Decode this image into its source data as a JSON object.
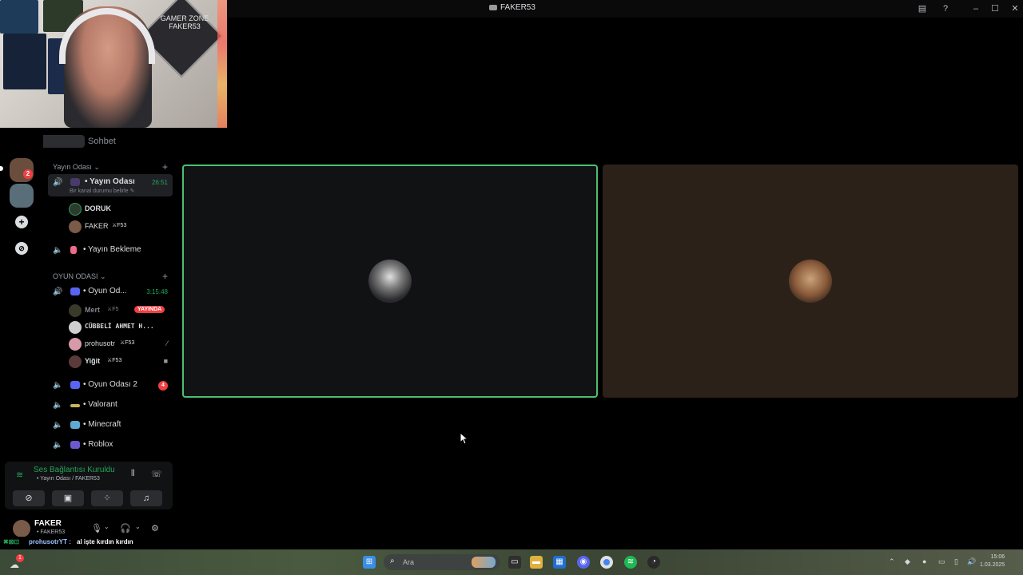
{
  "window": {
    "title": "FAKER53"
  },
  "webcam": {
    "poster_text": "GAMER ZONE FAKER53"
  },
  "server": {
    "header_text": "Sohbet"
  },
  "rail": {
    "badge_count": "2"
  },
  "channels": {
    "cat1": {
      "label": "Yayın Odası ⌄"
    },
    "yayin_odasi": {
      "name": "• Yayın Odası",
      "timer": "26:51",
      "sub": "Bir kanal durumu belirle ✎"
    },
    "members1": [
      {
        "name": "DORUK",
        "tag": ""
      },
      {
        "name": "FAKER",
        "tag": "⚔F53"
      }
    ],
    "yayin_bekleme": {
      "name": "• Yayın Bekleme"
    },
    "cat2": {
      "label": "OYUN ODASI ⌄"
    },
    "oyun_odasi": {
      "name": "• Oyun Od...",
      "timer": "3:15:48"
    },
    "members2": [
      {
        "name": "Mert",
        "tag": "⚔F5",
        "live": "YAYINDA"
      },
      {
        "name": "CÜBBELİ AHMET H...",
        "tag": ""
      },
      {
        "name": "prohusotr",
        "tag": "⚔F53"
      },
      {
        "name": "Yiğit",
        "tag": "⚔F53"
      }
    ],
    "oyun_odasi_2": {
      "name": "• Oyun Odası 2",
      "count": "4"
    },
    "valorant": {
      "name": "• Valorant"
    },
    "minecraft": {
      "name": "• Minecraft"
    },
    "roblox": {
      "name": "• Roblox"
    }
  },
  "voice_panel": {
    "status": "Ses Bağlantısı Kuruldu",
    "sub": "• Yayın Odası / FAKER53"
  },
  "userbar": {
    "name": "FAKER",
    "status": "• FAKER53"
  },
  "chat_overlay": {
    "icons": "✖⊠⊡",
    "user": "prohusotrYT :",
    "message": "al işte kırdın kırdın"
  },
  "taskbar": {
    "search_placeholder": "Ara",
    "notification_count": "1",
    "clock_time": "15:06",
    "clock_date": "1.03.2025"
  },
  "colors": {
    "accent_green": "#23a559",
    "danger": "#f23f43",
    "tile_speaking_border": "#4cbf72"
  }
}
